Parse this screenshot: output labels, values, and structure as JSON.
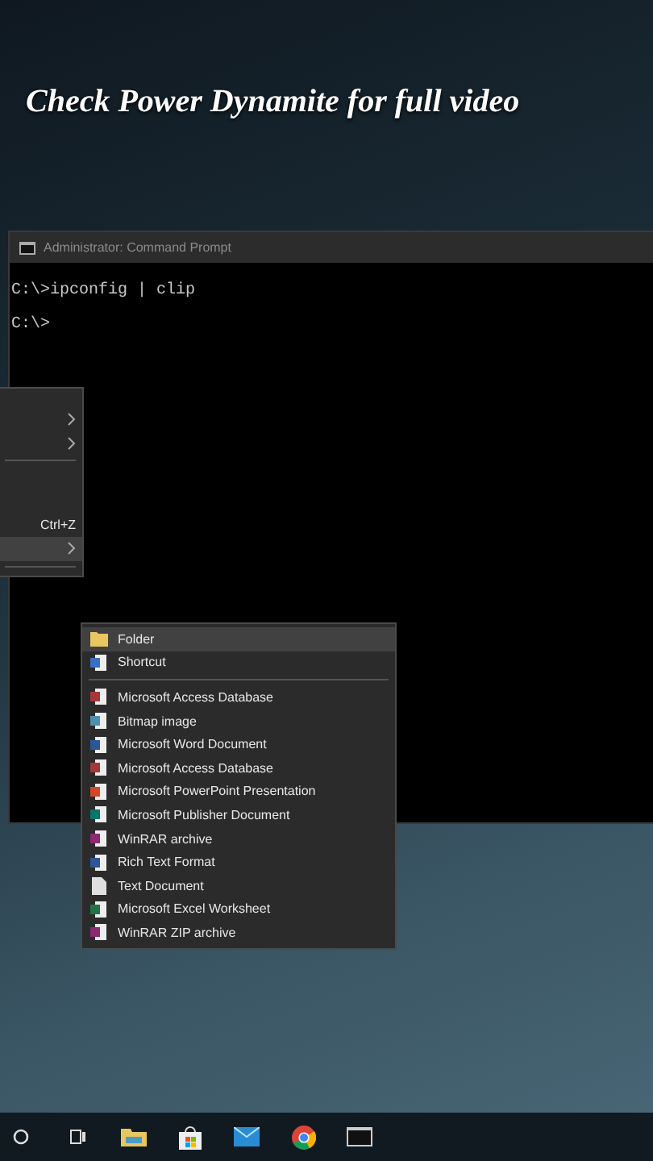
{
  "caption": "Check Power Dynamite for full video",
  "console_window": {
    "title": "Administrator: Command Prompt",
    "lines": [
      "C:\\>ipconfig | clip",
      "C:\\>"
    ]
  },
  "context_menu": {
    "items": [
      {
        "kind": "submenu",
        "highlighted": false
      },
      {
        "kind": "submenu",
        "highlighted": false
      },
      {
        "kind": "separator"
      },
      {
        "kind": "blank",
        "highlighted": false
      },
      {
        "kind": "blank",
        "highlighted": false
      },
      {
        "kind": "shortcut",
        "shortcut": "Ctrl+Z",
        "highlighted": false
      },
      {
        "kind": "submenu",
        "highlighted": true
      },
      {
        "kind": "separator"
      }
    ]
  },
  "new_submenu": {
    "items": [
      {
        "kind": "folder",
        "label": "Folder",
        "highlighted": true
      },
      {
        "kind": "shortcut",
        "label": "Shortcut",
        "highlighted": false
      },
      {
        "kind": "separator"
      },
      {
        "kind": "access",
        "label": "Microsoft Access Database",
        "highlighted": false
      },
      {
        "kind": "bitmap",
        "label": "Bitmap image",
        "highlighted": false
      },
      {
        "kind": "word",
        "label": "Microsoft Word Document",
        "highlighted": false
      },
      {
        "kind": "access",
        "label": "Microsoft Access Database",
        "highlighted": false
      },
      {
        "kind": "powerpoint",
        "label": "Microsoft PowerPoint Presentation",
        "highlighted": false
      },
      {
        "kind": "publisher",
        "label": "Microsoft Publisher Document",
        "highlighted": false
      },
      {
        "kind": "winrar",
        "label": "WinRAR archive",
        "highlighted": false
      },
      {
        "kind": "rtf",
        "label": "Rich Text Format",
        "highlighted": false
      },
      {
        "kind": "text",
        "label": "Text Document",
        "highlighted": false
      },
      {
        "kind": "excel",
        "label": "Microsoft Excel Worksheet",
        "highlighted": false
      },
      {
        "kind": "winrar",
        "label": "WinRAR ZIP archive",
        "highlighted": false
      }
    ]
  },
  "taskbar": {
    "items": [
      {
        "kind": "search"
      },
      {
        "kind": "taskview"
      },
      {
        "kind": "explorer"
      },
      {
        "kind": "store"
      },
      {
        "kind": "mail"
      },
      {
        "kind": "chrome"
      },
      {
        "kind": "console"
      }
    ]
  }
}
